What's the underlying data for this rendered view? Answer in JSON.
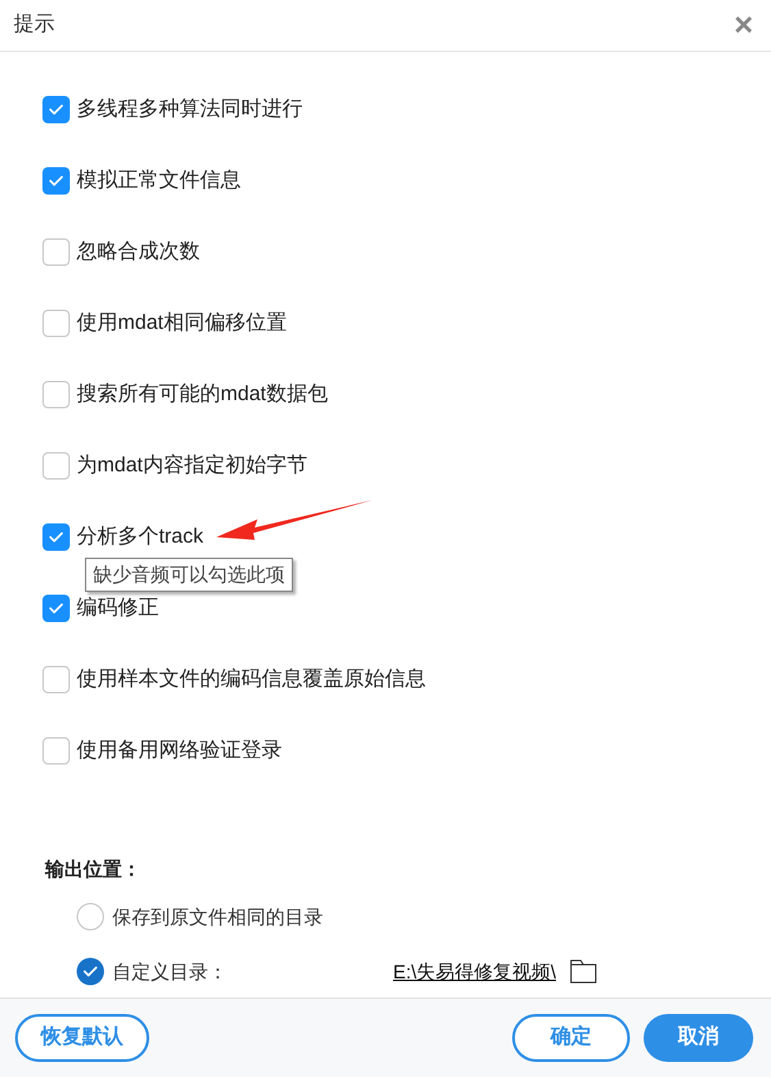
{
  "window": {
    "title": "提示",
    "close": "×"
  },
  "options": [
    {
      "label": "多线程多种算法同时进行",
      "checked": true
    },
    {
      "label": "模拟正常文件信息",
      "checked": true
    },
    {
      "label": "忽略合成次数",
      "checked": false
    },
    {
      "label": "使用mdat相同偏移位置",
      "checked": false
    },
    {
      "label": "搜索所有可能的mdat数据包",
      "checked": false
    },
    {
      "label": "为mdat内容指定初始字节",
      "checked": false
    },
    {
      "label": "分析多个track",
      "checked": true,
      "tooltip": "缺少音频可以勾选此项",
      "annotated": true
    },
    {
      "label": "编码修正",
      "checked": true
    },
    {
      "label": "使用样本文件的编码信息覆盖原始信息",
      "checked": false
    },
    {
      "label": "使用备用网络验证登录",
      "checked": false
    }
  ],
  "output": {
    "heading": "输出位置：",
    "choices": [
      {
        "label": "保存到原文件相同的目录",
        "selected": false
      },
      {
        "label": "自定义目录：",
        "selected": true,
        "path": "E:\\失易得修复视频\\"
      }
    ]
  },
  "buttons": [
    {
      "label": "恢复默认",
      "kind": "outline"
    },
    {
      "label": "确定",
      "kind": "outline"
    },
    {
      "label": "取消",
      "kind": "primary"
    }
  ]
}
